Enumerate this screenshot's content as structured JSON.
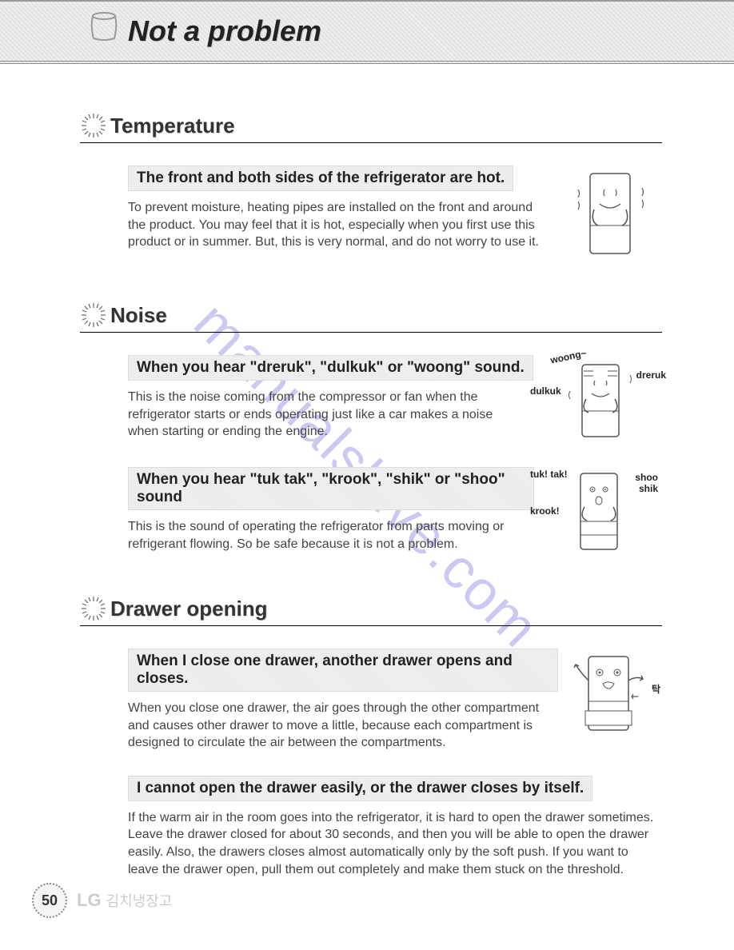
{
  "header": {
    "title": "Not a problem"
  },
  "sections": [
    {
      "title": "Temperature",
      "items": [
        {
          "title": "The front and both sides of the refrigerator are hot.",
          "body": "To prevent moisture, heating pipes are installed on the front and around the product. You may feel that it is hot, especially when you first use this product or in summer. But, this is very normal, and do not worry to use it.",
          "illus": "fridge-hot"
        }
      ]
    },
    {
      "title": "Noise",
      "items": [
        {
          "title": "When you hear \"dreruk\", \"dulkuk\" or \"woong\" sound.",
          "body": "This is the noise coming from the compressor or fan when the refrigerator starts or ends operating just like a car makes a noise when starting or ending the engine.",
          "illus": "fridge-noise1",
          "labels": {
            "woong": "woong~",
            "dreruk": "dreruk",
            "dulkuk": "dulkuk"
          }
        },
        {
          "title": "When you hear \"tuk tak\", \"krook\", \"shik\" or \"shoo\" sound",
          "body": "This is the sound of operating the refrigerator from parts moving or refrigerant flowing. So be safe because it is not a problem.",
          "illus": "fridge-noise2",
          "labels": {
            "tuktak": "tuk! tak!",
            "shoo": "shoo",
            "shik": "shik",
            "krook": "krook!"
          }
        }
      ]
    },
    {
      "title": "Drawer opening",
      "items": [
        {
          "title": "When I close one drawer, another drawer opens and closes.",
          "body": "When you close one drawer, the air goes through the other compartment and causes other drawer to move a little, because each compartment is designed to circulate the air between the compartments.",
          "illus": "fridge-drawer",
          "labels": {
            "tak": "탁"
          }
        },
        {
          "title": "I cannot open the drawer easily, or the drawer closes by itself.",
          "body": "If the warm air in the room goes into the refrigerator, it is hard to open the drawer sometimes. Leave the drawer closed for about 30 seconds, and then you will be able to open the drawer easily. Also, the drawers closes almost automatically only by the soft push. If you want to leave the drawer open, pull them out completely and make them stuck on the threshold.",
          "illus": null
        }
      ]
    }
  ],
  "footer": {
    "page": "50",
    "brand": "LG",
    "korean": "김치냉장고"
  },
  "watermark": "manualshive.com"
}
